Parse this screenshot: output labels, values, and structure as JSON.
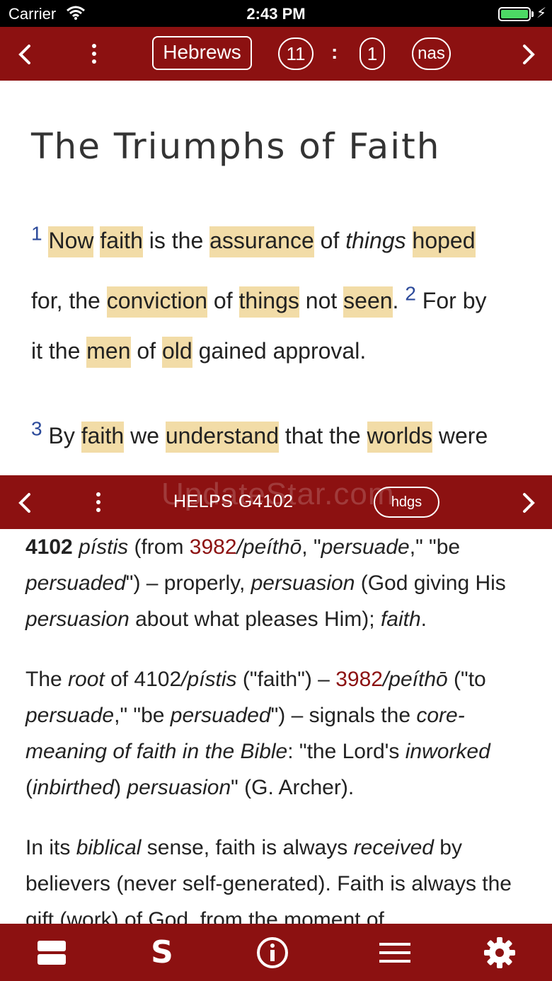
{
  "status_bar": {
    "carrier": "Carrier",
    "time": "2:43 PM"
  },
  "nav": {
    "book": "Hebrews",
    "chapter": "11",
    "separator": ":",
    "verse": "1",
    "version": "nas"
  },
  "passage": {
    "heading": "The Triumphs of Faith",
    "verse_1_number": "1",
    "verse_2_number": "2",
    "verse_3_number": "3",
    "words": {
      "now": "Now",
      "faith": "faith",
      "is_the": "is the",
      "assurance": "assurance",
      "of": "of",
      "things": "things",
      "hoped": "hoped",
      "for_the": "for, the",
      "conviction": "conviction",
      "not": "not",
      "seen": "seen",
      "period": ".",
      "for_by": "For by",
      "it_the": "it the",
      "men": "men",
      "old": "old",
      "gained_approval": "gained approval.",
      "by": "By",
      "we": "we",
      "understand": "understand",
      "that_the": "that the",
      "worlds": "worlds",
      "were": "were"
    }
  },
  "lexicon": {
    "title": "HELPS G4102",
    "watermark": "UpdateStar.com",
    "hdgs_label": "hdgs",
    "p1": {
      "num": "4102",
      "t1": "pístis",
      "t2": " (from ",
      "ref": "3982",
      "t3": "/peíthō",
      "t4": ", \"",
      "t5": "persuade",
      "t6": ",\" \"be ",
      "t7": "persuaded",
      "t8": "\") – properly, ",
      "t9": "persuasion",
      "t10": " (God giving His ",
      "t11": "persuasion",
      "t12": " about what pleases Him); ",
      "t13": "faith",
      "t14": "."
    },
    "p2": {
      "t1": "The ",
      "t2": "root",
      "t3": " of 4102",
      "t4": "/pístis",
      "t5": " (\"faith\") – ",
      "ref": "3982",
      "t6": "/peíthō",
      "t7": " (\"to ",
      "t8": "persuade",
      "t9": ",\" \"be ",
      "t10": "persuaded",
      "t11": "\") – signals the ",
      "t12": "core-meaning of faith in the Bible",
      "t13": ": \"the Lord's ",
      "t14": "inworked",
      "t15": " (",
      "t16": "inbirthed",
      "t17": ") ",
      "t18": "persuasion",
      "t19": "\" (G. Archer)."
    },
    "p3": {
      "t1": "In its ",
      "t2": "biblical",
      "t3": " sense, faith is always ",
      "t4": "received",
      "t5": " by believers (never self-generated).  Faith is always the gift (work) of God, from the moment of"
    }
  },
  "tabbar": {
    "items": [
      "layout-icon",
      "strongs-icon",
      "info-icon",
      "menu-icon",
      "settings-icon"
    ],
    "strongs_glyph": "S"
  },
  "colors": {
    "brand": "#8c1111",
    "highlight": "#f2dca7",
    "verse_number": "#2c4a9a"
  }
}
